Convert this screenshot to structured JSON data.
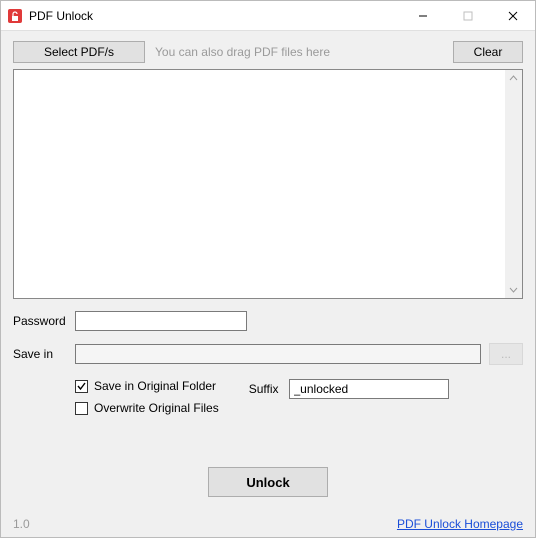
{
  "window": {
    "title": "PDF Unlock"
  },
  "toolbar": {
    "select_label": "Select PDF/s",
    "hint": "You can also drag PDF files here",
    "clear_label": "Clear"
  },
  "files": [],
  "form": {
    "password_label": "Password",
    "password_value": "",
    "savein_label": "Save in",
    "savein_value": "",
    "browse_label": "..."
  },
  "options": {
    "save_original_label": "Save in Original Folder",
    "save_original_checked": true,
    "overwrite_label": "Overwrite Original Files",
    "overwrite_checked": false,
    "suffix_label": "Suffix",
    "suffix_value": "_unlocked"
  },
  "actions": {
    "unlock_label": "Unlock"
  },
  "footer": {
    "version": "1.0",
    "homepage_label": "PDF Unlock Homepage"
  }
}
